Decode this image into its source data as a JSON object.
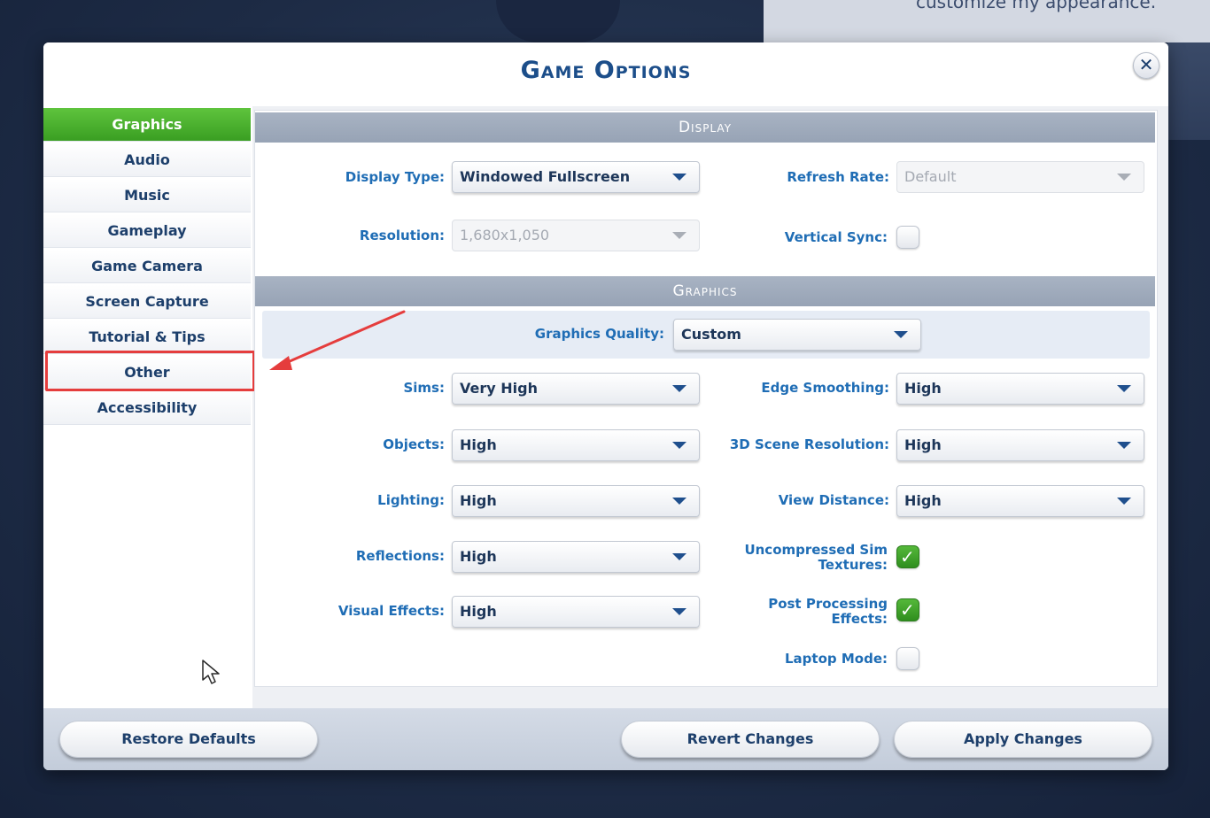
{
  "background": {
    "text": "customize my appearance."
  },
  "dialog": {
    "title": "Game Options",
    "close_label": "✕"
  },
  "sidebar": {
    "items": [
      {
        "label": "Graphics",
        "active": true
      },
      {
        "label": "Audio",
        "active": false
      },
      {
        "label": "Music",
        "active": false
      },
      {
        "label": "Gameplay",
        "active": false
      },
      {
        "label": "Game Camera",
        "active": false
      },
      {
        "label": "Screen Capture",
        "active": false
      },
      {
        "label": "Tutorial & Tips",
        "active": false
      },
      {
        "label": "Other",
        "active": false
      },
      {
        "label": "Accessibility",
        "active": false
      }
    ]
  },
  "display": {
    "header": "Display",
    "display_type_label": "Display Type:",
    "display_type_value": "Windowed Fullscreen",
    "refresh_rate_label": "Refresh Rate:",
    "refresh_rate_value": "Default",
    "resolution_label": "Resolution:",
    "resolution_value": "1,680x1,050",
    "vsync_label": "Vertical Sync:",
    "vsync_checked": false
  },
  "graphics": {
    "header": "Graphics",
    "quality_label": "Graphics Quality:",
    "quality_value": "Custom",
    "sims_label": "Sims:",
    "sims_value": "Very High",
    "objects_label": "Objects:",
    "objects_value": "High",
    "lighting_label": "Lighting:",
    "lighting_value": "High",
    "reflections_label": "Reflections:",
    "reflections_value": "High",
    "visual_effects_label": "Visual Effects:",
    "visual_effects_value": "High",
    "edge_smoothing_label": "Edge Smoothing:",
    "edge_smoothing_value": "High",
    "scene_resolution_label": "3D Scene Resolution:",
    "scene_resolution_value": "High",
    "view_distance_label": "View Distance:",
    "view_distance_value": "High",
    "uncompressed_label_line1": "Uncompressed Sim",
    "uncompressed_label_line2": "Textures:",
    "uncompressed_checked": true,
    "post_processing_label_line1": "Post Processing",
    "post_processing_label_line2": "Effects:",
    "post_processing_checked": true,
    "laptop_mode_label": "Laptop Mode:",
    "laptop_mode_checked": false
  },
  "footer": {
    "restore_defaults": "Restore Defaults",
    "revert_changes": "Revert Changes",
    "apply_changes": "Apply Changes"
  },
  "colors": {
    "accent_green": "#4cb22f",
    "label_blue": "#1f6db5",
    "title_blue": "#1c4e8a",
    "annotation_red": "#e53d3d"
  },
  "icons": {
    "close": "close-icon",
    "dropdown": "chevron-down-icon",
    "check": "checkmark-icon",
    "cursor": "mouse-pointer-icon",
    "annotation_arrow": "annotation-arrow-icon"
  }
}
